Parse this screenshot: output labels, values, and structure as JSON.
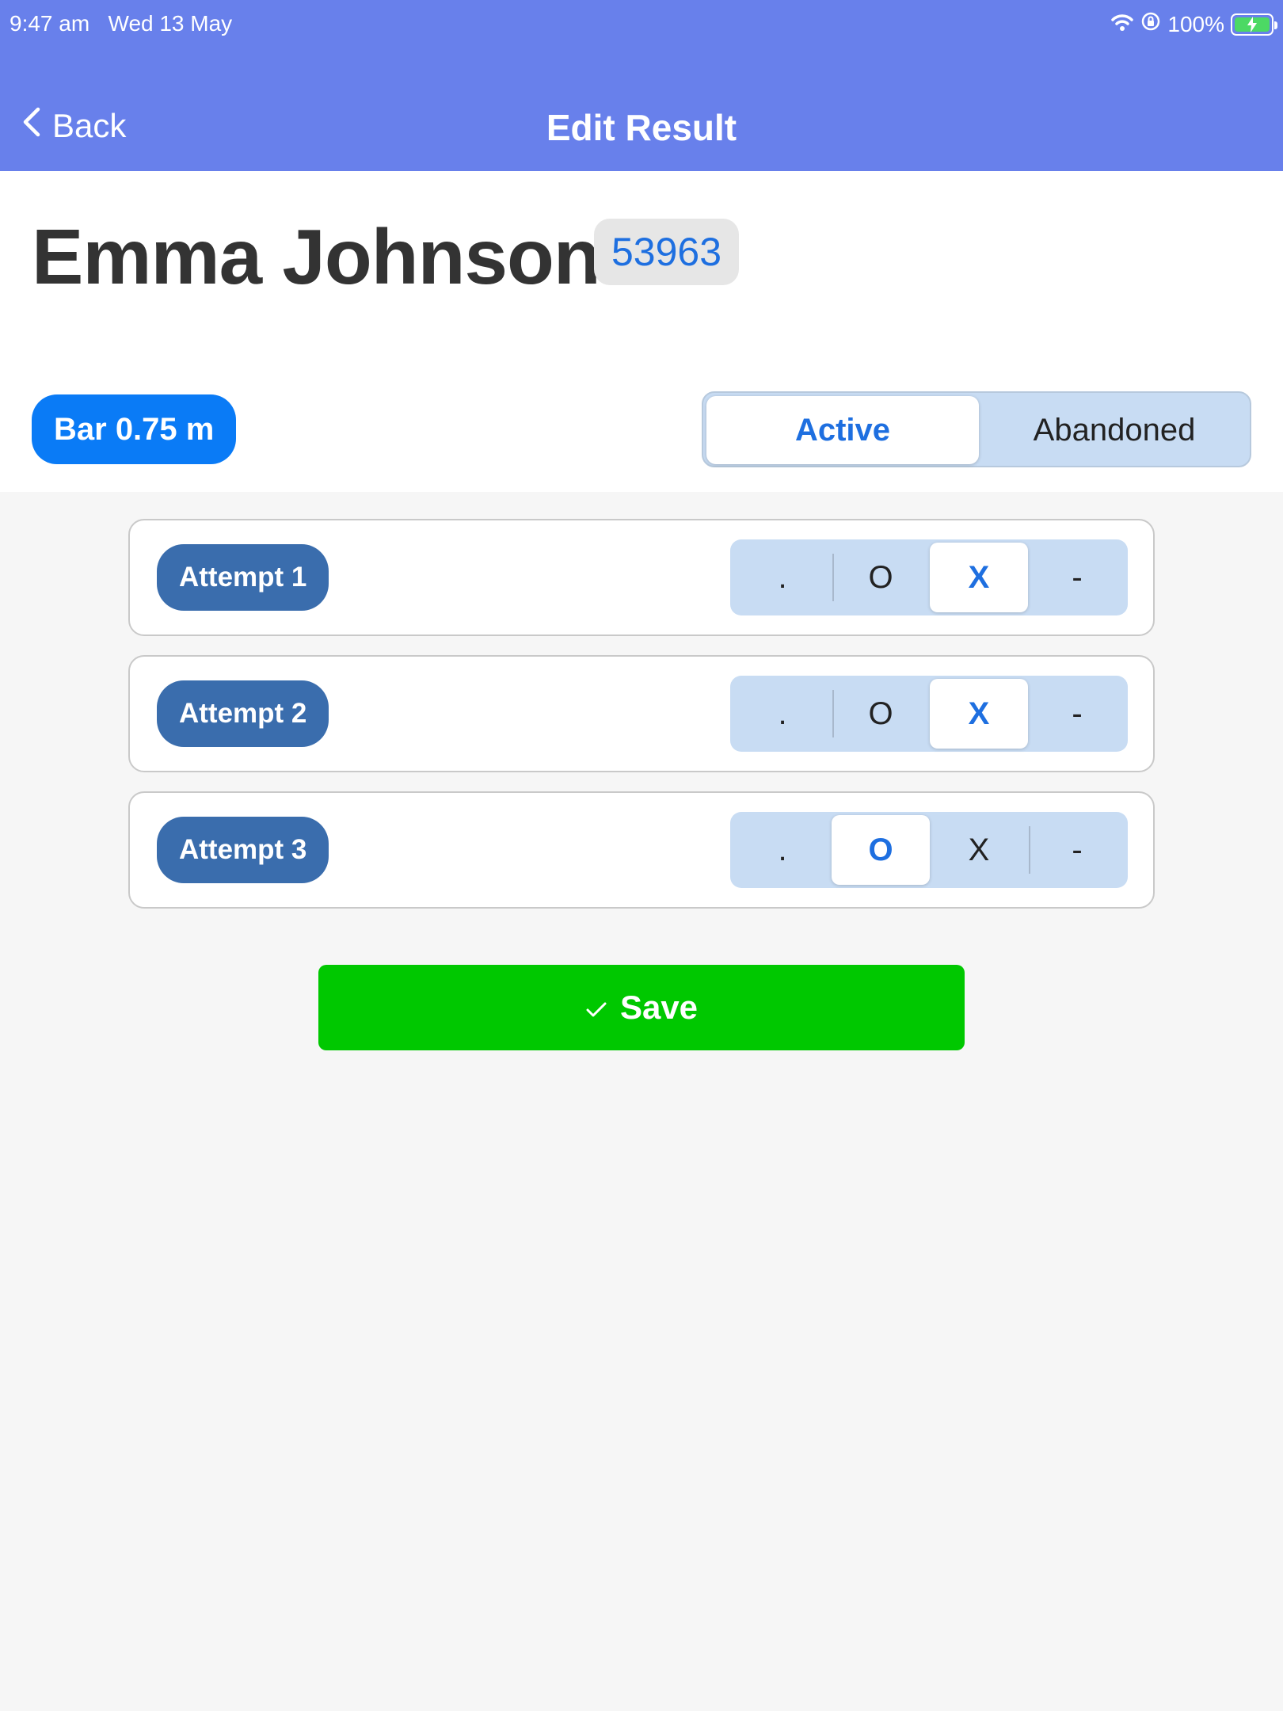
{
  "status_bar": {
    "time": "9:47 am",
    "date": "Wed 13 May",
    "battery": "100%"
  },
  "nav": {
    "back_label": "Back",
    "title": "Edit Result"
  },
  "athlete": {
    "name": "Emma Johnson",
    "bib": "53963"
  },
  "bar": {
    "label": "Bar 0.75 m"
  },
  "status": {
    "options": [
      "Active",
      "Abandoned"
    ],
    "selected": "Active"
  },
  "attempts": [
    {
      "label": "Attempt 1",
      "options": [
        ".",
        "O",
        "X",
        "-"
      ],
      "selected": "X"
    },
    {
      "label": "Attempt 2",
      "options": [
        ".",
        "O",
        "X",
        "-"
      ],
      "selected": "X"
    },
    {
      "label": "Attempt 3",
      "options": [
        ".",
        "O",
        "X",
        "-"
      ],
      "selected": "O"
    }
  ],
  "save": {
    "label": "Save",
    "icon": "checkmark-icon"
  },
  "colors": {
    "nav_bar": "#6880eb",
    "accent_blue": "#1e6fe0",
    "bar_badge": "#0a7bf6",
    "attempt_label": "#3a6dad",
    "segment_bg": "#c8dcf3",
    "save_green": "#00c800"
  }
}
